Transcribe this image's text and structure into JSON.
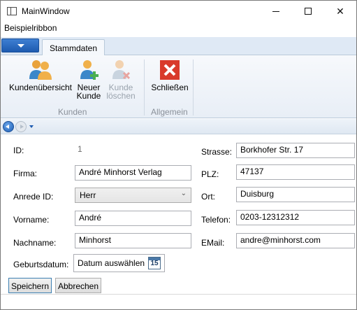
{
  "window": {
    "title": "MainWindow"
  },
  "menu": {
    "item": "Beispielribbon"
  },
  "ribbon": {
    "tab": "Stammdaten",
    "buttons": {
      "kundenuebersicht": "Kundenübersicht",
      "neuer_kunde_line1": "Neuer",
      "neuer_kunde_line2": "Kunde",
      "kunde_loeschen_line1": "Kunde",
      "kunde_loeschen_line2": "löschen",
      "schliessen": "Schließen"
    },
    "groups": {
      "kunden": "Kunden",
      "allgemein": "Allgemein"
    }
  },
  "form": {
    "labels": {
      "id": "ID:",
      "firma": "Firma:",
      "anrede": "Anrede ID:",
      "vorname": "Vorname:",
      "nachname": "Nachname:",
      "geburtsdatum": "Geburtsdatum:",
      "strasse": "Strasse:",
      "plz": "PLZ:",
      "ort": "Ort:",
      "telefon": "Telefon:",
      "email": "EMail:"
    },
    "values": {
      "id": "1",
      "firma": "André Minhorst Verlag",
      "anrede": "Herr",
      "vorname": "André",
      "nachname": "Minhorst",
      "geburtsdatum_placeholder": "Datum auswählen",
      "calendar_day": "15",
      "strasse": "Borkhofer Str. 17",
      "plz": "47137",
      "ort": "Duisburg",
      "telefon": "0203-12312312",
      "email": "andre@minhorst.com"
    },
    "buttons": {
      "save": "Speichern",
      "cancel": "Abbrechen"
    }
  }
}
